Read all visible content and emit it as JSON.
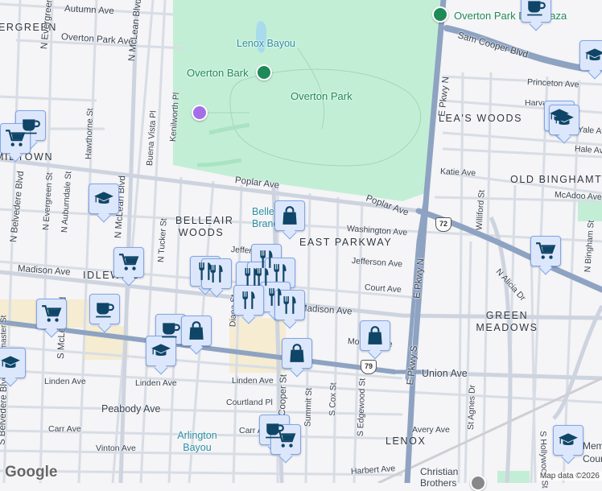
{
  "map": {
    "colors": {
      "background": "#f5f4f6",
      "park": "#c3eed6",
      "highway": "#8ea3c2",
      "road": "#d8dde5",
      "commercial": "#f5ecd1",
      "marker_fill": "#dde7fb",
      "marker_icon": "#0f4566"
    },
    "neighborhoods": [
      "ERGREEN",
      "MIDTOWN",
      "BELLEAIR WOODS",
      "EAST PARKWAY",
      "IDLEWILD",
      "LEA'S WOODS",
      "OLD BINGHAMTON",
      "GREEN MEADOWS",
      "LENOX"
    ],
    "parks": [
      "Overton Bark",
      "Overton Park",
      "Overton Park Dog Plaza"
    ],
    "water": [
      "Lenox Bayou",
      "Arlington Bayou"
    ],
    "places": [
      "Belleair Branch",
      "Christian Brothers",
      "Memphis Country"
    ],
    "streets": {
      "autumn": "Autumn Ave",
      "overton_park": "Overton Park Ave",
      "n_evergreen": "N Evergreen St",
      "n_mclean": "N McLean Blvd",
      "kenilworth": "Kenilworth Pl",
      "buena_vista": "Buena Vista Pl",
      "hawthorne": "Hawthorne St",
      "poplar": "Poplar Ave",
      "poplar2": "Poplar Ave",
      "n_belvedere": "N Belvedere Blvd",
      "n_evergreen2": "N Evergreen St",
      "n_auburndale": "N Auburndale St",
      "n_mclean2": "N McLean Blvd",
      "n_tucker": "N Tucker St",
      "washington": "Washington Ave",
      "jefferson": "Jefferson Ave",
      "jefferson2": "Jefferson Ave",
      "madison": "Madison Ave",
      "madison2": "Madison Ave",
      "court": "Court Ave",
      "monroe": "Monroe Ave",
      "union": "Union Ave",
      "linden": "Linden Ave",
      "linden2": "Linden Ave",
      "linden3": "Linden Ave",
      "peabody": "Peabody Ave",
      "courtland": "Courtland Pl",
      "carr": "Carr Ave",
      "carr2": "Carr Ave",
      "vinton": "Vinton Ave",
      "harbert": "Harbert Ave",
      "avery": "Avery Ave",
      "lemaster": "Lemaster St",
      "s_belvedere": "S Belvedere Blvd",
      "s_mclean": "S McLean Blvd",
      "diana": "Diana St",
      "cooper": "Cooper St",
      "summit": "Summit St",
      "s_cox": "S Cox St",
      "s_edgewood": "S Edgewood St",
      "e_pkwy_n": "E Pkwy N",
      "e_pkwy_n2": "E Pkwy N",
      "e_pkwy_s": "E Pkwy S",
      "sam_cooper": "Sam Cooper Blvd",
      "princeton": "Princeton Ave",
      "harvard": "Harvard Ave",
      "yale": "Yale Ave",
      "hale": "Hale Ave",
      "katie": "Katie Ave",
      "mcadoo": "McAdoo Ave",
      "williford": "Williford St",
      "n_alicia": "N Alicia Dr",
      "n_bingham": "N Bingham St",
      "st_agnes": "St Agnes Dr",
      "s_hollywood": "S Hollywood St"
    },
    "route_shields": [
      "72",
      "79"
    ],
    "attribution": {
      "logo": "Google",
      "text": "Map data ©2026"
    }
  }
}
